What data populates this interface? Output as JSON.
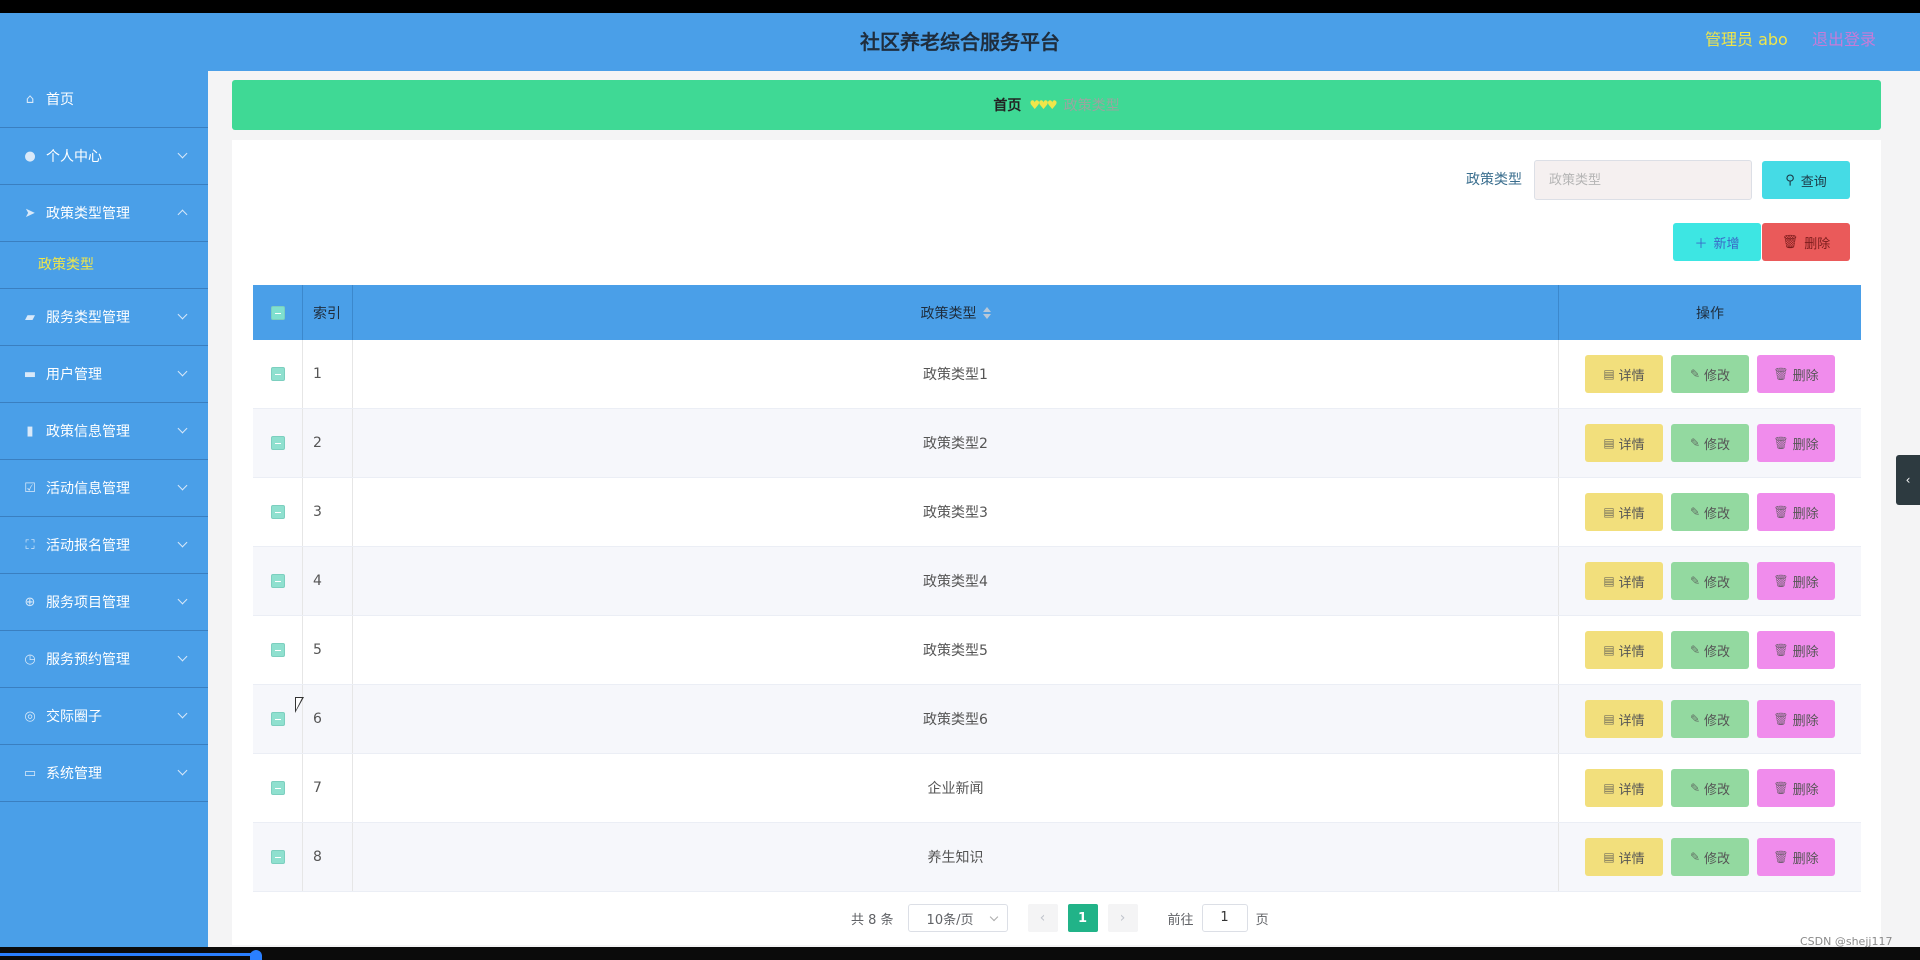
{
  "app": {
    "title": "社区养老综合服务平台",
    "admin_label": "管理员 abo",
    "logout_label": "退出登录"
  },
  "sidebar": {
    "items": [
      {
        "label": "首页",
        "icon": "home-icon"
      },
      {
        "label": "个人中心",
        "icon": "user-icon"
      },
      {
        "label": "政策类型管理",
        "icon": "send-icon",
        "expanded": true,
        "sub": [
          "政策类型"
        ]
      },
      {
        "label": "服务类型管理",
        "icon": "briefcase-icon"
      },
      {
        "label": "用户管理",
        "icon": "suitcase-icon"
      },
      {
        "label": "政策信息管理",
        "icon": "clipboard-icon"
      },
      {
        "label": "活动信息管理",
        "icon": "checked-icon"
      },
      {
        "label": "活动报名管理",
        "icon": "fullscreen-icon"
      },
      {
        "label": "服务项目管理",
        "icon": "aim-icon"
      },
      {
        "label": "服务预约管理",
        "icon": "clock-icon"
      },
      {
        "label": "交际圈子",
        "icon": "compass-icon"
      },
      {
        "label": "系统管理",
        "icon": "ticket-icon"
      }
    ]
  },
  "breadcrumb": {
    "home": "首页",
    "separator": "♥♥♥",
    "current": "政策类型"
  },
  "search": {
    "label": "政策类型",
    "placeholder": "政策类型",
    "button": "查询"
  },
  "actions": {
    "add": "新增",
    "delete": "删除"
  },
  "table": {
    "headers": {
      "index": "索引",
      "type": "政策类型",
      "ops": "操作"
    },
    "op_labels": {
      "detail": "详情",
      "edit": "修改",
      "delete": "删除"
    },
    "rows": [
      {
        "index": "1",
        "type": "政策类型1"
      },
      {
        "index": "2",
        "type": "政策类型2"
      },
      {
        "index": "3",
        "type": "政策类型3"
      },
      {
        "index": "4",
        "type": "政策类型4"
      },
      {
        "index": "5",
        "type": "政策类型5"
      },
      {
        "index": "6",
        "type": "政策类型6"
      },
      {
        "index": "7",
        "type": "企业新闻"
      },
      {
        "index": "8",
        "type": "养生知识"
      }
    ]
  },
  "pagination": {
    "total": "共 8 条",
    "page_size": "10条/页",
    "current_page": "1",
    "goto_prefix": "前往",
    "goto_value": "1",
    "goto_suffix": "页"
  },
  "watermark": "CSDN @shejj117",
  "colors": {
    "header_bg": "#4a9fe8",
    "breadcrumb_bg": "#3fd995",
    "active_sub": "#f0e64a",
    "page_active": "#21b388"
  }
}
